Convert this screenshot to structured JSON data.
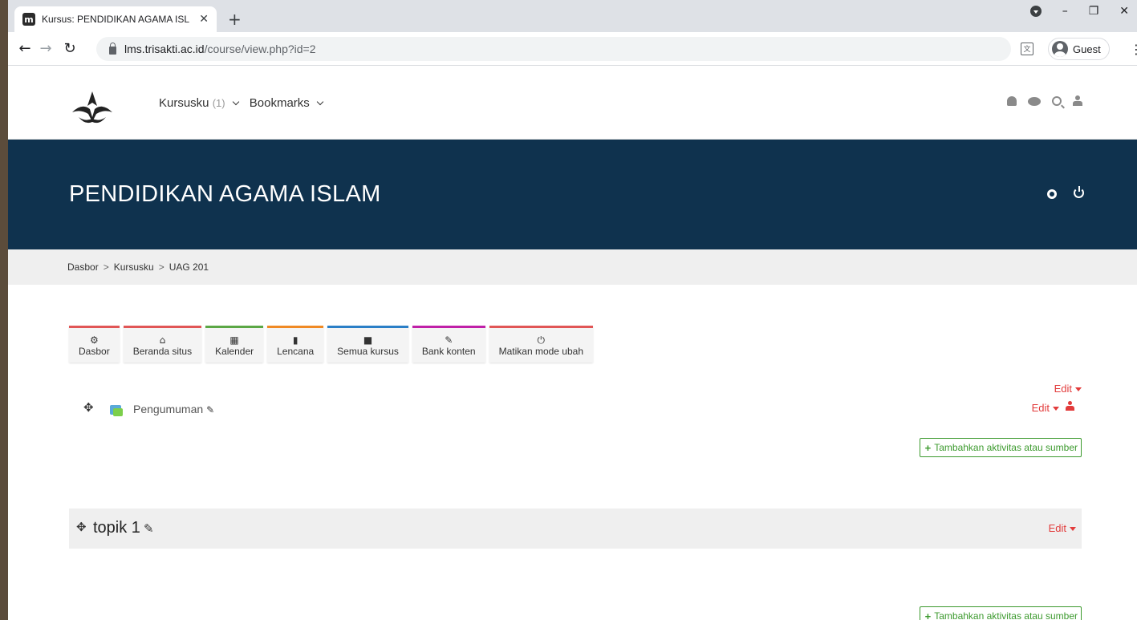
{
  "browser": {
    "tab_title": "Kursus: PENDIDIKAN AGAMA ISL",
    "tab_favicon": "m",
    "new_tab": "+",
    "url_host": "lms.trisakti.ac.id",
    "url_path": "/course/view.php?id=2",
    "profile_label": "Guest",
    "win_minimize": "–",
    "win_restore": "❐",
    "win_close": "✕"
  },
  "navbar": {
    "kursusku": "Kursusku",
    "kursusku_count": "(1)",
    "bookmarks": "Bookmarks"
  },
  "course": {
    "title": "PENDIDIKAN AGAMA ISLAM"
  },
  "breadcrumb": {
    "items": [
      "Dasbor",
      "Kursusku",
      "UAG 201"
    ],
    "sep": ">"
  },
  "quicklinks": [
    {
      "label": "Dasbor",
      "icon": "⚙"
    },
    {
      "label": "Beranda situs",
      "icon": "⌂"
    },
    {
      "label": "Kalender",
      "icon": "▦"
    },
    {
      "label": "Lencana",
      "icon": "▮"
    },
    {
      "label": "Semua kursus",
      "icon": "■"
    },
    {
      "label": "Bank konten",
      "icon": "✎"
    },
    {
      "label": "Matikan mode ubah",
      "icon": "⏻"
    }
  ],
  "section0": {
    "edit_label": "Edit",
    "activity_name": "Pengumuman",
    "activity_edit_label": "Edit",
    "add_label": "Tambahkan aktivitas atau sumber"
  },
  "section1": {
    "title": "topik 1",
    "edit_label": "Edit",
    "add_label": "Tambahkan aktivitas atau sumber"
  },
  "colors": {
    "header_bg": "#0f324e",
    "edit_red": "#e23b3b",
    "add_green": "#3c9a2e"
  }
}
